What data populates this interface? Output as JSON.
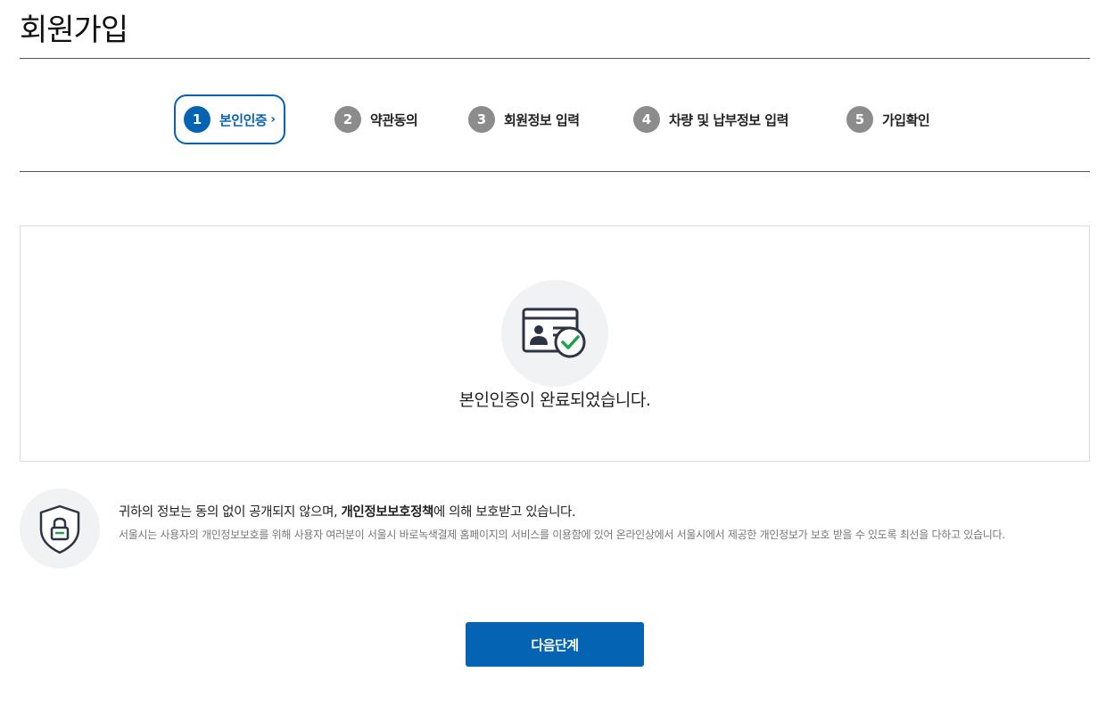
{
  "page": {
    "title": "회원가입"
  },
  "steps": [
    {
      "num": "1",
      "label": "본인인증",
      "chevron": "›",
      "active": true
    },
    {
      "num": "2",
      "label": "약관동의",
      "active": false
    },
    {
      "num": "3",
      "label": "회원정보 입력",
      "active": false
    },
    {
      "num": "4",
      "label": "차량 및 납부정보 입력",
      "active": false
    },
    {
      "num": "5",
      "label": "가입확인",
      "active": false
    }
  ],
  "result": {
    "icon": "id-card-check-icon",
    "message": "본인인증이 완료되었습니다."
  },
  "privacy": {
    "icon": "shield-lock-icon",
    "main_prefix": "귀하의 정보는 동의 없이 공개되지 않으며, ",
    "main_bold": "개인정보보호정책",
    "main_suffix": "에 의해 보호받고 있습니다.",
    "detail": "서울시는 사용자의 개인정보보호를 위해 사용자 여러분이 서울시 바로녹색결제 홈페이지의 서비스를 이용함에 있어 온라인상에서 서울시에서 제공한 개인정보가 보호 받을 수 있도록 최선을 다하고 있습니다."
  },
  "actions": {
    "next_label": "다음단계"
  },
  "colors": {
    "accent": "#0563b3",
    "inactive_step": "#8c8c8c",
    "check": "#1aa34a",
    "icon_bg": "#f1f2f4"
  }
}
